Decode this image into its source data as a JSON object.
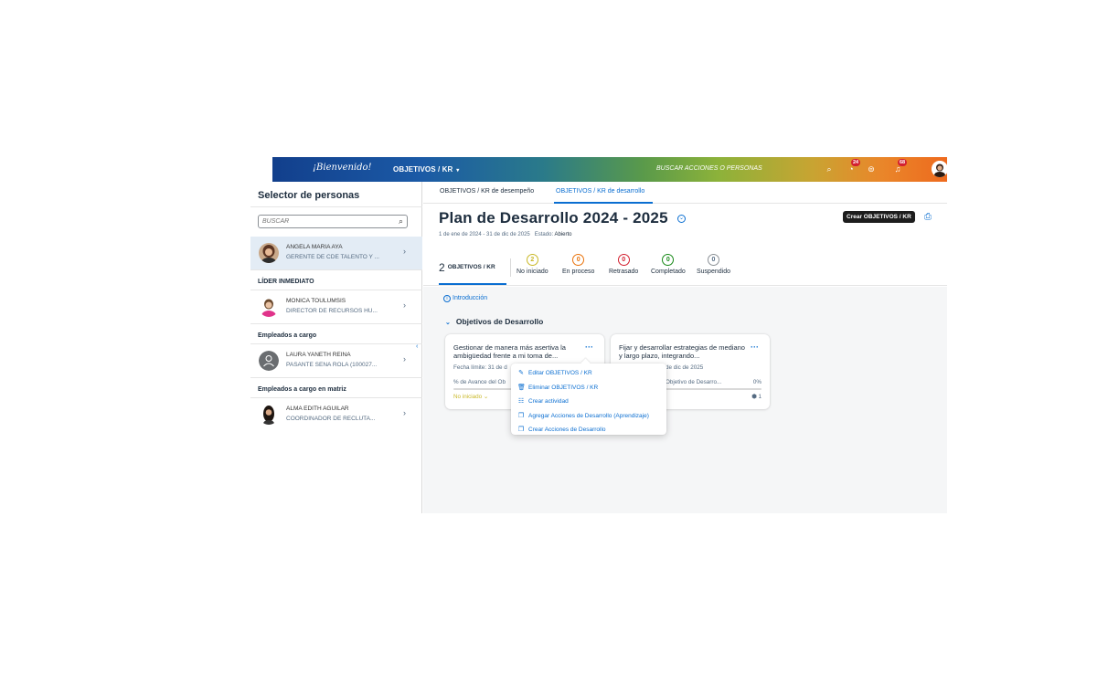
{
  "topbar": {
    "logo_text": "¡Bienvenido!",
    "menu_label": "OBJETIVOS / KR",
    "search_text": "BUSCAR ACCIONES O PERSONAS",
    "tasks_badge": "24",
    "notifications_badge": "68",
    "icons": [
      "search-icon",
      "tasks-icon",
      "chat-icon",
      "bell-icon"
    ],
    "gradient_colors": [
      "#123f8c",
      "#5a9a4a",
      "#ee6a1e"
    ]
  },
  "sidebar": {
    "title": "Selector de personas",
    "search_placeholder": "BUSCAR",
    "selected_person": {
      "name": "ANGELA MARIA AYA",
      "role": "GERENTE DE CDE TALENTO Y ..."
    },
    "sections": [
      {
        "label": "LÍDER INMEDIATO",
        "people": [
          {
            "name": "MONICA TOULUMSIS",
            "role": "DIRECTOR DE RECURSOS HU..."
          }
        ]
      },
      {
        "label": "Empleados a cargo",
        "people": [
          {
            "name": "LAURA YANETH REINA",
            "role": "PASANTE SENA ROLA (100027..."
          }
        ]
      },
      {
        "label": "Empleados a cargo en matriz",
        "people": [
          {
            "name": "ALMA EDITH AGUILAR",
            "role": "COORDINADOR DE RECLUTA..."
          }
        ]
      }
    ]
  },
  "main": {
    "tabs": [
      {
        "label": "OBJETIVOS / KR de desempeño",
        "active": false
      },
      {
        "label": "OBJETIVOS / KR de desarrollo",
        "active": true
      }
    ],
    "title": "Plan de Desarrollo 2024 - 2025",
    "date_range": "1 de ene de 2024 - 31 de dic de 2025",
    "status_label": "Estado:",
    "status_value": "Abierto",
    "create_button": "Crear OBJETIVOS / KR",
    "stats": {
      "total_count": "2",
      "total_label": "OBJETIVOS / KR",
      "items": [
        {
          "value": "2",
          "label": "No iniciado",
          "color": "#c9b827"
        },
        {
          "value": "0",
          "label": "En proceso",
          "color": "#e9730c"
        },
        {
          "value": "0",
          "label": "Retrasado",
          "color": "#d32030"
        },
        {
          "value": "0",
          "label": "Completado",
          "color": "#188918"
        },
        {
          "value": "0",
          "label": "Suspendido",
          "color": "#8c9196"
        }
      ]
    },
    "intro_link": "Introducción",
    "section_title": "Objetivos de Desarrollo",
    "cards": [
      {
        "title": "Gestionar de manera más asertiva la ambigüedad frente a mi toma de...",
        "date": "Fecha límite: 31 de d",
        "progress_label": "% de Avance del Ob",
        "percent": "",
        "status": "No iniciado",
        "count": ""
      },
      {
        "title": "Fijar y desarrollar estrategias de mediano y largo plazo, integrando...",
        "date": "de dic de 2025",
        "progress_label": "Objetivo de Desarro...",
        "percent": "0%",
        "status": "",
        "count": "1"
      }
    ],
    "menu_items": [
      {
        "label": "Editar OBJETIVOS / KR",
        "icon": "pencil-icon"
      },
      {
        "label": "Eliminar OBJETIVOS / KR",
        "icon": "trash-icon"
      },
      {
        "label": "Crear actividad",
        "icon": "activity-icon"
      },
      {
        "label": "Agregar Acciones de Desarrollo (Aprendizaje)",
        "icon": "copy-icon"
      },
      {
        "label": "Crear Acciones de Desarrollo",
        "icon": "copy-icon"
      }
    ]
  }
}
